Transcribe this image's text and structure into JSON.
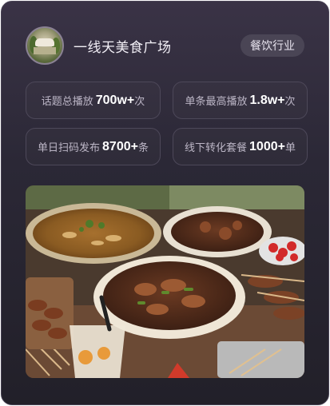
{
  "header": {
    "brand_name": "一线天美食广场",
    "tag": "餐饮行业",
    "avatar_icon": "restaurant-building-photo"
  },
  "stats": [
    {
      "label": "话题总播放",
      "value": "700w+",
      "unit": "次"
    },
    {
      "label": "单条最高播放",
      "value": "1.8w+",
      "unit": "次"
    },
    {
      "label": "单日扫码发布",
      "value": "8700+",
      "unit": "条"
    },
    {
      "label": "线下转化套餐",
      "value": "1000+",
      "unit": "单"
    }
  ],
  "photo": {
    "subject": "food-table-photo"
  },
  "colors": {
    "card_bg_top": "#3a3346",
    "card_bg_bottom": "#222029",
    "tag_bg": "#4a4555",
    "stat_border": "#4d4859"
  }
}
